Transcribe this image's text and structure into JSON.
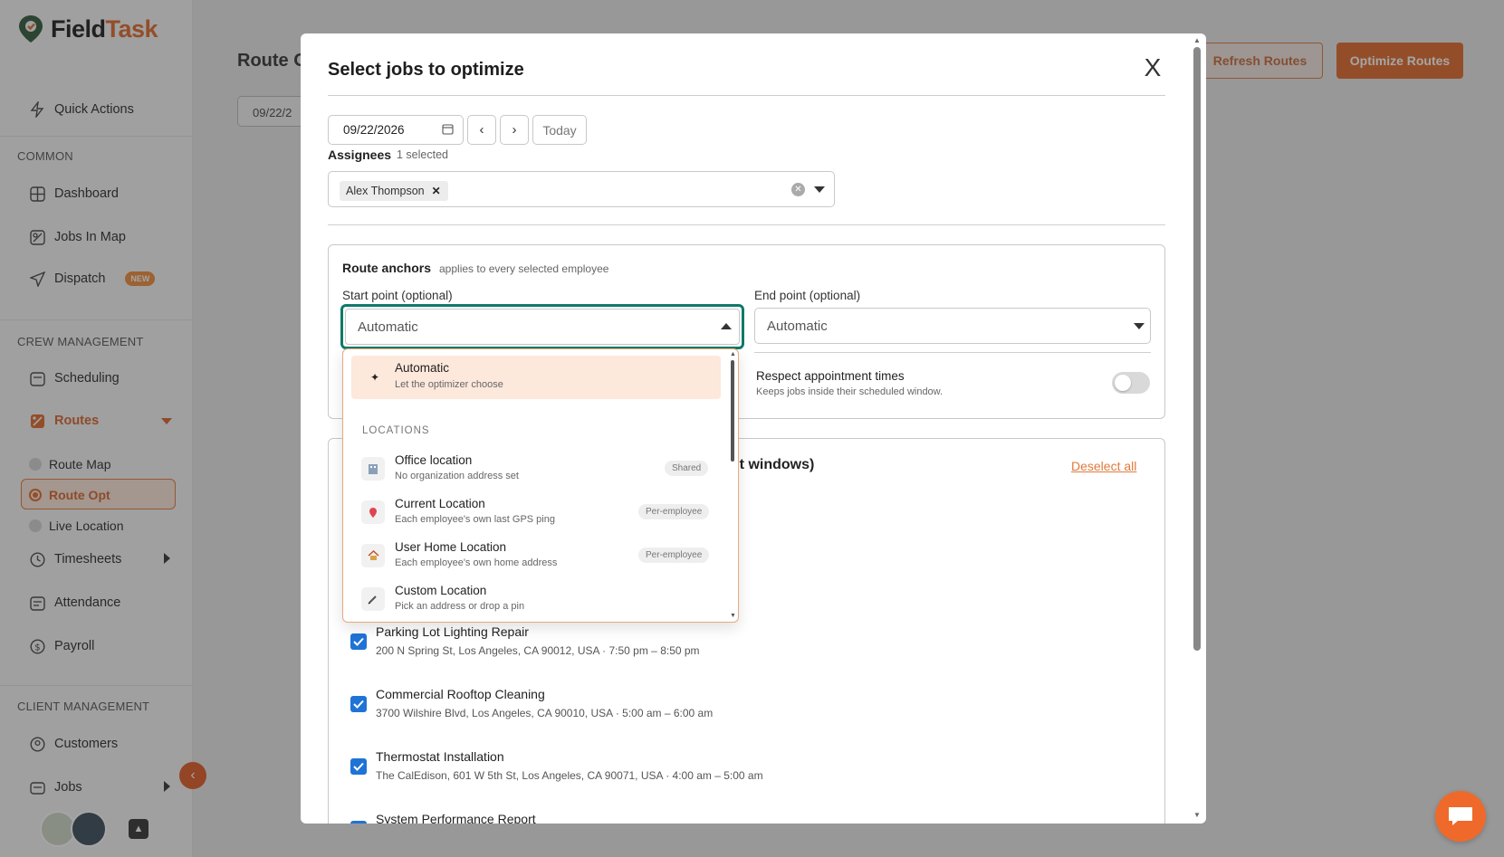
{
  "app": {
    "brand_part1": "Field",
    "brand_part2": "Task"
  },
  "sidebar": {
    "quick_actions": "Quick Actions",
    "section_common": "COMMON",
    "dashboard": "Dashboard",
    "jobs_in_map": "Jobs In Map",
    "dispatch": "Dispatch",
    "dispatch_badge": "NEW",
    "section_crew": "CREW MANAGEMENT",
    "scheduling": "Scheduling",
    "routes": "Routes",
    "route_map": "Route Map",
    "route_opt": "Route Opt",
    "live_location": "Live Location",
    "timesheets": "Timesheets",
    "attendance": "Attendance",
    "payroll": "Payroll",
    "section_client": "CLIENT MANAGEMENT",
    "customers": "Customers",
    "jobs": "Jobs"
  },
  "main": {
    "title": "Route O",
    "date": "09/22/2",
    "refresh_label": "Refresh Routes",
    "optimize_label": "Optimize Routes"
  },
  "modal": {
    "title": "Select jobs to optimize",
    "close_label": "X",
    "date_value": "09/22/2026",
    "today_label": "Today",
    "assignees_label": "Assignees",
    "assignees_count": "1 selected",
    "assignee_chip": "Alex Thompson",
    "anchors": {
      "title": "Route anchors",
      "note": "applies to every selected employee",
      "start_label": "Start point (optional)",
      "start_value": "Automatic",
      "end_label": "End point (optional)",
      "end_value": "Automatic",
      "respect_title": "Respect appointment times",
      "respect_sub": "Keeps jobs inside their scheduled window."
    },
    "jobs_section_title_visible": "ent windows)",
    "deselect_all": "Deselect all",
    "jobs": [
      {
        "title": "Parking Lot Lighting Repair",
        "sub": "200 N Spring St, Los Angeles, CA 90012, USA · 7:50 pm – 8:50 pm"
      },
      {
        "title": "Commercial Rooftop Cleaning",
        "sub": "3700 Wilshire Blvd, Los Angeles, CA 90010, USA · 5:00 am – 6:00 am"
      },
      {
        "title": "Thermostat Installation",
        "sub": "The CalEdison, 601 W 5th St, Los Angeles, CA 90071, USA · 4:00 am – 5:00 am"
      },
      {
        "title": "System Performance Report",
        "sub": ""
      }
    ]
  },
  "dropdown": {
    "auto_title": "Automatic",
    "auto_sub": "Let the optimizer choose",
    "section_locations": "LOCATIONS",
    "items": [
      {
        "title": "Office location",
        "sub": "No organization address set",
        "tag": "Shared"
      },
      {
        "title": "Current Location",
        "sub": "Each employee's own last GPS ping",
        "tag": "Per-employee"
      },
      {
        "title": "User Home Location",
        "sub": "Each employee's own home address",
        "tag": "Per-employee"
      },
      {
        "title": "Custom Location",
        "sub": "Pick an address or drop a pin",
        "tag": ""
      }
    ]
  },
  "colors": {
    "accent": "#e0692a",
    "focus": "#0f7a68",
    "checkbox": "#1f73d6"
  }
}
